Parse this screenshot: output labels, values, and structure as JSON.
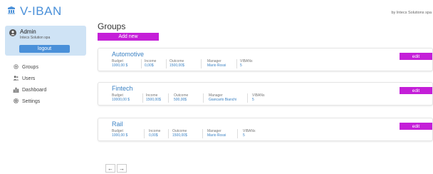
{
  "header": {
    "app_title": "V-IBAN",
    "by_text": "by Intecs Solutions spa"
  },
  "user": {
    "name": "Admin",
    "company": "Intecs Solution spa",
    "logout_label": "logout"
  },
  "nav": {
    "items": [
      {
        "label": "Groups",
        "icon": "gear-icon"
      },
      {
        "label": "Users",
        "icon": "users-icon"
      },
      {
        "label": "Dashboard",
        "icon": "dashboard-icon"
      },
      {
        "label": "Settings",
        "icon": "settings-icon"
      }
    ]
  },
  "main": {
    "title": "Groups",
    "add_label": "Add new",
    "edit_label": "edit",
    "field_labels": {
      "budget": "Budget",
      "income": "Income",
      "outcome": "Outcome",
      "manager": "Manager",
      "vibans": "VIBANs"
    },
    "groups": [
      {
        "name": "Automotive",
        "budget": "1000,00 $",
        "income": "0,00$",
        "outcome": "1500,00$",
        "manager": "Mario Rossi",
        "vibans": "5"
      },
      {
        "name": "Fintech",
        "budget": "10000,00 $",
        "income": "1500,00$",
        "outcome": "500,00$",
        "manager": "Giancarlo Bianchi",
        "vibans": "5"
      },
      {
        "name": "Rail",
        "budget": "1000,00 $",
        "income": "0,00$",
        "outcome": "1500,00$",
        "manager": "Mario Rossi",
        "vibans": "5"
      }
    ]
  },
  "pager": {
    "prev": "←",
    "next": "→"
  },
  "colors": {
    "accent_purple": "#c41fd8",
    "accent_blue": "#4a90d9",
    "user_card_bg": "#cfe3f5"
  }
}
